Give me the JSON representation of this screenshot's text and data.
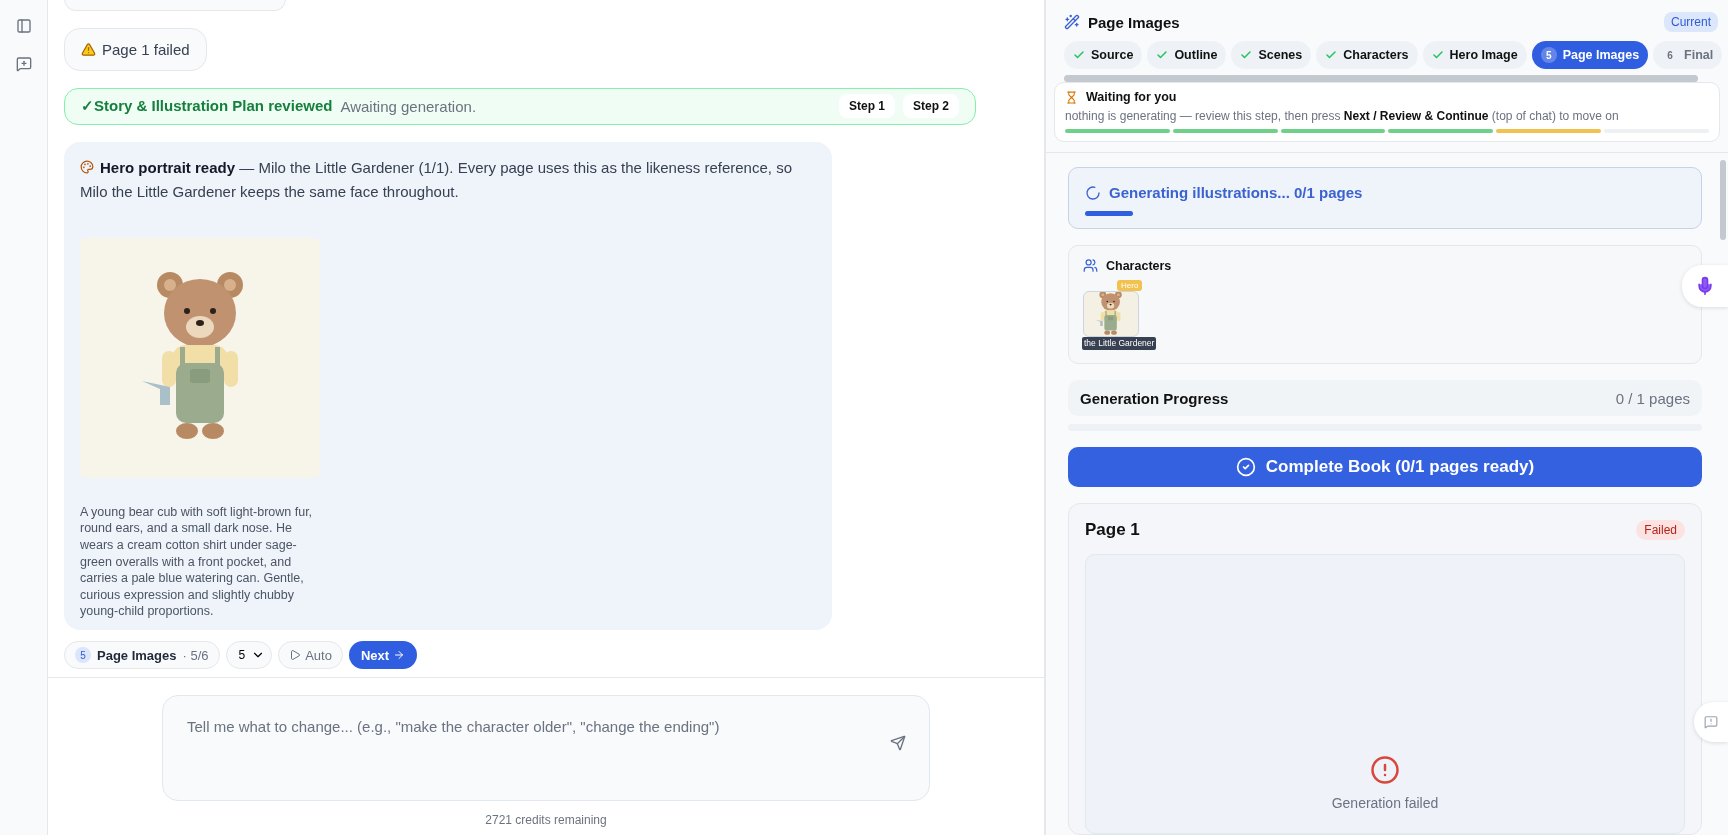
{
  "chat": {
    "messages": [
      {
        "kind": "stub"
      },
      {
        "kind": "notice",
        "text": "Page 1 failed"
      },
      {
        "kind": "review",
        "title": "✓Story & Illustration Plan reviewed",
        "note": "Awaiting generation.",
        "steps": [
          "Step 1",
          "Step 2"
        ]
      },
      {
        "kind": "hero",
        "text": "**Hero portrait ready** — Milo the Little Gardener (1/1). Every page uses this as the likeness reference, so Milo the Little Gardener keeps the same face throughout.",
        "caption": "A young bear cub with soft light-brown fur, round ears, and a small dark nose. He wears a cream cotton shirt under sage-green overalls with a front pocket, and carries a pale blue watering can. Gentle, curious expression and slightly chubby young-child proportions."
      }
    ],
    "step_bar": {
      "number": "5",
      "label": "Page Images",
      "progress": "· 5/6",
      "select_value": "5",
      "auto_label": "Auto",
      "next_label": "Next"
    },
    "composer": {
      "placeholder": "Tell me what to change... (e.g., \"make the character older\", \"change the ending\")",
      "credits": "2721 credits remaining"
    }
  },
  "panel": {
    "title": "Page Images",
    "badge": "Current",
    "steps": [
      {
        "label": "Source",
        "kind": "done",
        "selected": false
      },
      {
        "label": "Outline",
        "kind": "done",
        "selected": false
      },
      {
        "label": "Scenes",
        "kind": "done",
        "selected": false
      },
      {
        "label": "Characters",
        "kind": "done",
        "selected": false
      },
      {
        "label": "Hero Image",
        "kind": "done",
        "selected": false
      },
      {
        "number": "5",
        "label": "Page Images",
        "kind": "current",
        "selected": true
      },
      {
        "number": "6",
        "label": "Final",
        "kind": "upcoming",
        "selected": false
      }
    ],
    "waiting": {
      "title": "Waiting for you",
      "message": "nothing is generating — review this step, then press **Next / Review & Continue** (top of chat) to move on",
      "segments": [
        {
          "kind": "done"
        },
        {
          "kind": "done"
        },
        {
          "kind": "done"
        },
        {
          "kind": "done"
        },
        {
          "kind": "current"
        },
        {
          "kind": "pending"
        }
      ]
    },
    "generating": {
      "text": "Generating illustrations... 0/1 pages",
      "level": 0.07
    },
    "characters": {
      "title": "Characters",
      "items": [
        {
          "name": "the Little Gardener",
          "badge": "Hero"
        }
      ]
    },
    "progress": {
      "title": "Generation Progress",
      "count": "0 / 1 pages"
    },
    "complete_button": "Complete Book (0/1 pages ready)",
    "pages": [
      {
        "title": "Page 1",
        "kind": "failed",
        "badge": "Failed",
        "message": "Generation failed"
      }
    ]
  }
}
